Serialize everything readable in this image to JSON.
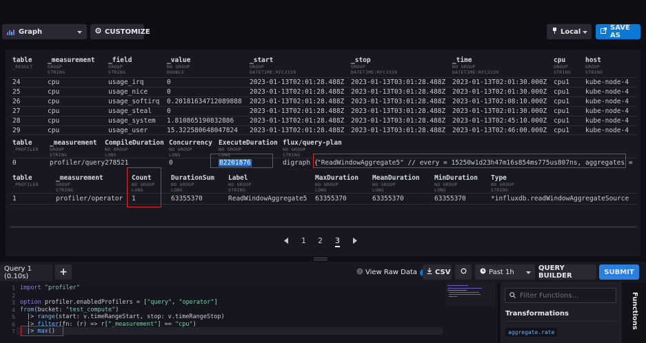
{
  "toolbar": {
    "graph_label": "Graph",
    "customize_label": "CUSTOMIZE",
    "timezone_label": "Local",
    "save_as_label": "SAVE AS"
  },
  "table1": {
    "headers": [
      {
        "name": "table",
        "group": "_RESULT",
        "type": ""
      },
      {
        "name": "_measurement",
        "group": "GROUP",
        "type": "STRING"
      },
      {
        "name": "_field",
        "group": "GROUP",
        "type": "STRING"
      },
      {
        "name": "_value",
        "group": "NO GROUP",
        "type": "DOUBLE"
      },
      {
        "name": "_start",
        "group": "GROUP",
        "type": "DATETIME:RFC3339"
      },
      {
        "name": "_stop",
        "group": "GROUP",
        "type": "DATETIME:RFC3339"
      },
      {
        "name": "_time",
        "group": "NO GROUP",
        "type": "DATETIME:RFC3339"
      },
      {
        "name": "cpu",
        "group": "GROUP",
        "type": "STRING"
      },
      {
        "name": "host",
        "group": "GROUP",
        "type": "STRING"
      }
    ],
    "rows": [
      [
        "24",
        "cpu",
        "usage_irq",
        "0",
        "2023-01-13T02:01:28.488Z",
        "2023-01-13T03:01:28.488Z",
        "2023-01-13T02:01:30.000Z",
        "cpu1",
        "kube-node-4"
      ],
      [
        "25",
        "cpu",
        "usage_nice",
        "0",
        "2023-01-13T02:01:28.488Z",
        "2023-01-13T03:01:28.488Z",
        "2023-01-13T02:01:30.000Z",
        "cpu1",
        "kube-node-4"
      ],
      [
        "26",
        "cpu",
        "usage_softirq",
        "0.20181634712089888",
        "2023-01-13T02:01:28.488Z",
        "2023-01-13T03:01:28.488Z",
        "2023-01-13T02:08:10.000Z",
        "cpu1",
        "kube-node-4"
      ],
      [
        "27",
        "cpu",
        "usage_steal",
        "0",
        "2023-01-13T02:01:28.488Z",
        "2023-01-13T03:01:28.488Z",
        "2023-01-13T02:01:30.000Z",
        "cpu1",
        "kube-node-4"
      ],
      [
        "28",
        "cpu",
        "usage_system",
        "1.810865190832886",
        "2023-01-13T02:01:28.488Z",
        "2023-01-13T03:01:28.488Z",
        "2023-01-13T02:45:10.000Z",
        "cpu1",
        "kube-node-4"
      ],
      [
        "29",
        "cpu",
        "usage_user",
        "15.322580648047824",
        "2023-01-13T02:01:28.488Z",
        "2023-01-13T03:01:28.488Z",
        "2023-01-13T02:46:00.000Z",
        "cpu1",
        "kube-node-4"
      ]
    ]
  },
  "table2": {
    "headers": [
      {
        "name": "table",
        "group": "_PROFILER",
        "type": ""
      },
      {
        "name": "_measurement",
        "group": "GROUP",
        "type": "STRING"
      },
      {
        "name": "CompileDuration",
        "group": "NO GROUP",
        "type": "LONG"
      },
      {
        "name": "Concurrency",
        "group": "NO GROUP",
        "type": "LONG"
      },
      {
        "name": "ExecuteDuration",
        "group": "NO GROUP",
        "type": "LONG"
      },
      {
        "name": "flux/query-plan",
        "group": "NO GROUP",
        "type": "STRING"
      }
    ],
    "row": [
      "0",
      "profiler/query",
      "278521",
      "0",
      "82201876",
      "digraph {",
      "\"ReadWindowAggregate5\" // every = 15250w1d23h47m16s854ms775us807ns, aggregates = [max], createE"
    ]
  },
  "table3": {
    "headers": [
      {
        "name": "table",
        "group": "_PROFILER",
        "type": ""
      },
      {
        "name": "_measurement",
        "group": "GROUP",
        "type": "STRING"
      },
      {
        "name": "Count",
        "group": "NO GROUP",
        "type": "LONG"
      },
      {
        "name": "DurationSum",
        "group": "NO GROUP",
        "type": "LONG"
      },
      {
        "name": "Label",
        "group": "NO GROUP",
        "type": "STRING"
      },
      {
        "name": "MaxDuration",
        "group": "NO GROUP",
        "type": "LONG"
      },
      {
        "name": "MeanDuration",
        "group": "NO GROUP",
        "type": "LONG"
      },
      {
        "name": "MinDuration",
        "group": "NO GROUP",
        "type": "LONG"
      },
      {
        "name": "Type",
        "group": "NO GROUP",
        "type": "STRING"
      }
    ],
    "row": [
      "1",
      "profiler/operator",
      "1",
      "63355370",
      "ReadWindowAggregate5",
      "63355370",
      "63355370",
      "63355370",
      "*influxdb.readWindowAggregateSource"
    ]
  },
  "pagination": {
    "pages": [
      "1",
      "2",
      "3"
    ],
    "current": "3"
  },
  "querybar": {
    "tab_label": "Query 1 (0.10s)",
    "add_label": "+",
    "raw_data_label": "View Raw Data",
    "csv_label": "CSV",
    "time_range_label": "Past 1h",
    "query_builder_label": "QUERY BUILDER",
    "submit_label": "SUBMIT"
  },
  "editor": {
    "line_numbers": [
      "1",
      "2",
      "3",
      "4",
      "5",
      "6",
      "7"
    ],
    "lines": {
      "l1_kw": "import",
      "l1_str": "\"profiler\"",
      "l3_kw": "option",
      "l3_rest": "profiler.enabledProfilers = [",
      "l3_s1": "\"query\"",
      "l3_sep": ", ",
      "l3_s2": "\"operator\"",
      "l3_end": "]",
      "l4_fn": "from",
      "l4_a": "(bucket: ",
      "l4_s": "\"test_compute\"",
      "l4_b": ")",
      "l5_p": "|> ",
      "l5_fn": "range",
      "l5_rest": "(start: v.timeRangeStart, stop: v.timeRangeStop)",
      "l6_p": "|> ",
      "l6_fn": "filter",
      "l6_a": "(fn: (r) => r[",
      "l6_s1": "\"_measurement\"",
      "l6_b": "] == ",
      "l6_s2": "\"cpu\"",
      "l6_c": ")",
      "l7_p": "|> ",
      "l7_fn": "max",
      "l7_rest": "()"
    }
  },
  "functions": {
    "search_placeholder": "Filter Functions...",
    "section_label": "Transformations",
    "first_item": "aggregate.rate",
    "tab_label": "Functions"
  },
  "colors": {
    "accent": "#0c79d6",
    "highlight": "#e0242d",
    "selection": "#1d6fdb"
  }
}
